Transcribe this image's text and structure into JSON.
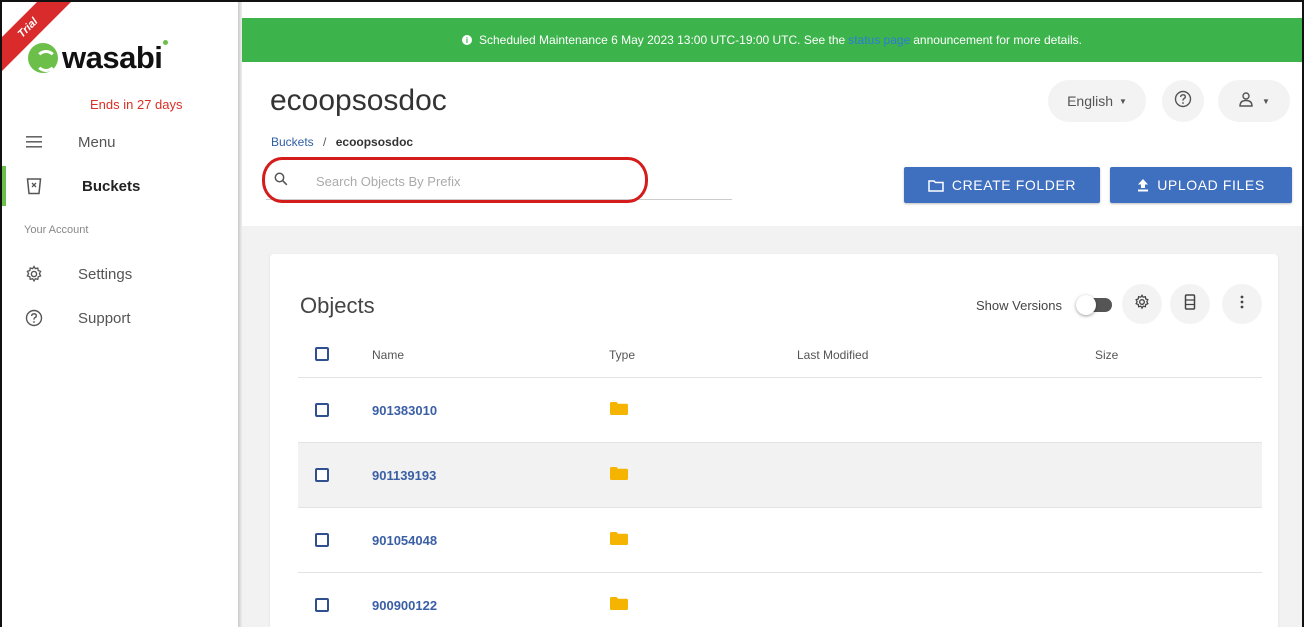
{
  "sidebar": {
    "trial_badge": "Trial",
    "logo_text": "wasabi",
    "ends_in": "Ends in 27 days",
    "items": [
      {
        "label": "Menu",
        "icon": "hamburger-icon"
      },
      {
        "label": "Buckets",
        "icon": "bucket-icon",
        "active": true
      },
      {
        "label": "Settings",
        "icon": "gear-icon"
      },
      {
        "label": "Support",
        "icon": "help-circle-icon"
      }
    ],
    "section_your_account": "Your Account"
  },
  "banner": {
    "text_before": "Scheduled Maintenance 6 May 2023 13:00 UTC-19:00 UTC. See the",
    "link": "status page",
    "text_after": "announcement for more details."
  },
  "header": {
    "title": "ecoopsosdoc",
    "language": "English",
    "breadcrumb": {
      "root": "Buckets",
      "separator": "/",
      "current": "ecoopsosdoc"
    }
  },
  "search": {
    "placeholder": "Search Objects By Prefix",
    "value": ""
  },
  "toolbar": {
    "create_folder": "CREATE FOLDER",
    "upload_files": "UPLOAD FILES"
  },
  "objects": {
    "title": "Objects",
    "show_versions_label": "Show Versions",
    "show_versions": false,
    "columns": [
      "Name",
      "Type",
      "Last Modified",
      "Size"
    ],
    "rows": [
      {
        "name": "901383010",
        "type": "folder"
      },
      {
        "name": "901139193",
        "type": "folder"
      },
      {
        "name": "901054048",
        "type": "folder"
      },
      {
        "name": "900900122",
        "type": "folder"
      }
    ]
  },
  "colors": {
    "accent_green": "#3cb44b",
    "primary_blue": "#3f6fbf",
    "link_blue": "#3a5fa5",
    "folder_yellow": "#f4b400",
    "highlight_red": "#d41c1c"
  }
}
